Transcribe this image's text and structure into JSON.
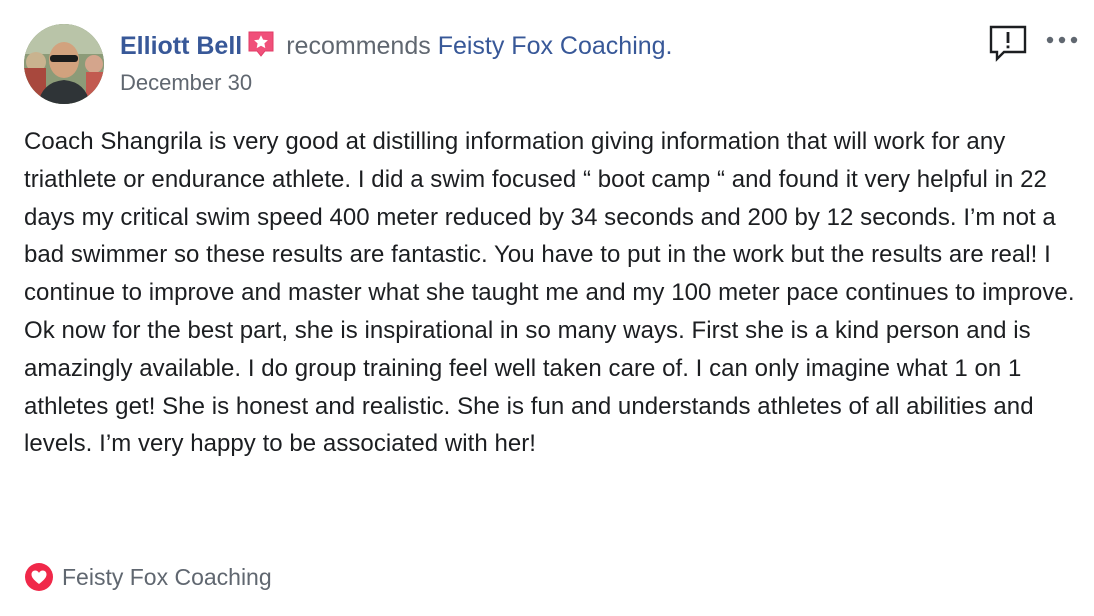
{
  "post": {
    "author": "Elliott Bell",
    "action_text": "recommends",
    "page_name": "Feisty Fox Coaching.",
    "date": "December 30",
    "body": "Coach Shangrila is very good at distilling information giving information that will work for any triathlete or endurance athlete. I did a swim focused “ boot camp “ and found it very helpful in 22 days my critical swim speed 400 meter reduced by 34 seconds and 200 by 12 seconds. I’m not a bad swimmer so these results are fantastic. You have to put in the work but the results are real! I continue to improve and master what she taught me and my 100 meter pace continues to improve. Ok now for the best part, she is inspirational in so many ways. First she is a kind person and is amazingly available. I do group training feel well taken care of. I can only imagine what 1 on 1 athletes get! She is honest and realistic. She is fun and understands athletes of all abilities and levels. I’m very happy to be associated with her!",
    "footer_label": "Feisty Fox Coaching"
  },
  "icons": {
    "badge": "star-badge-icon",
    "report": "report-icon",
    "more": "more-options-icon",
    "recommend": "heart-recommend-icon"
  },
  "colors": {
    "link": "#385898",
    "secondary_text": "#606770",
    "body_text": "#1c1e21",
    "badge_pink": "#f0507a",
    "heart_red": "#f02849"
  }
}
